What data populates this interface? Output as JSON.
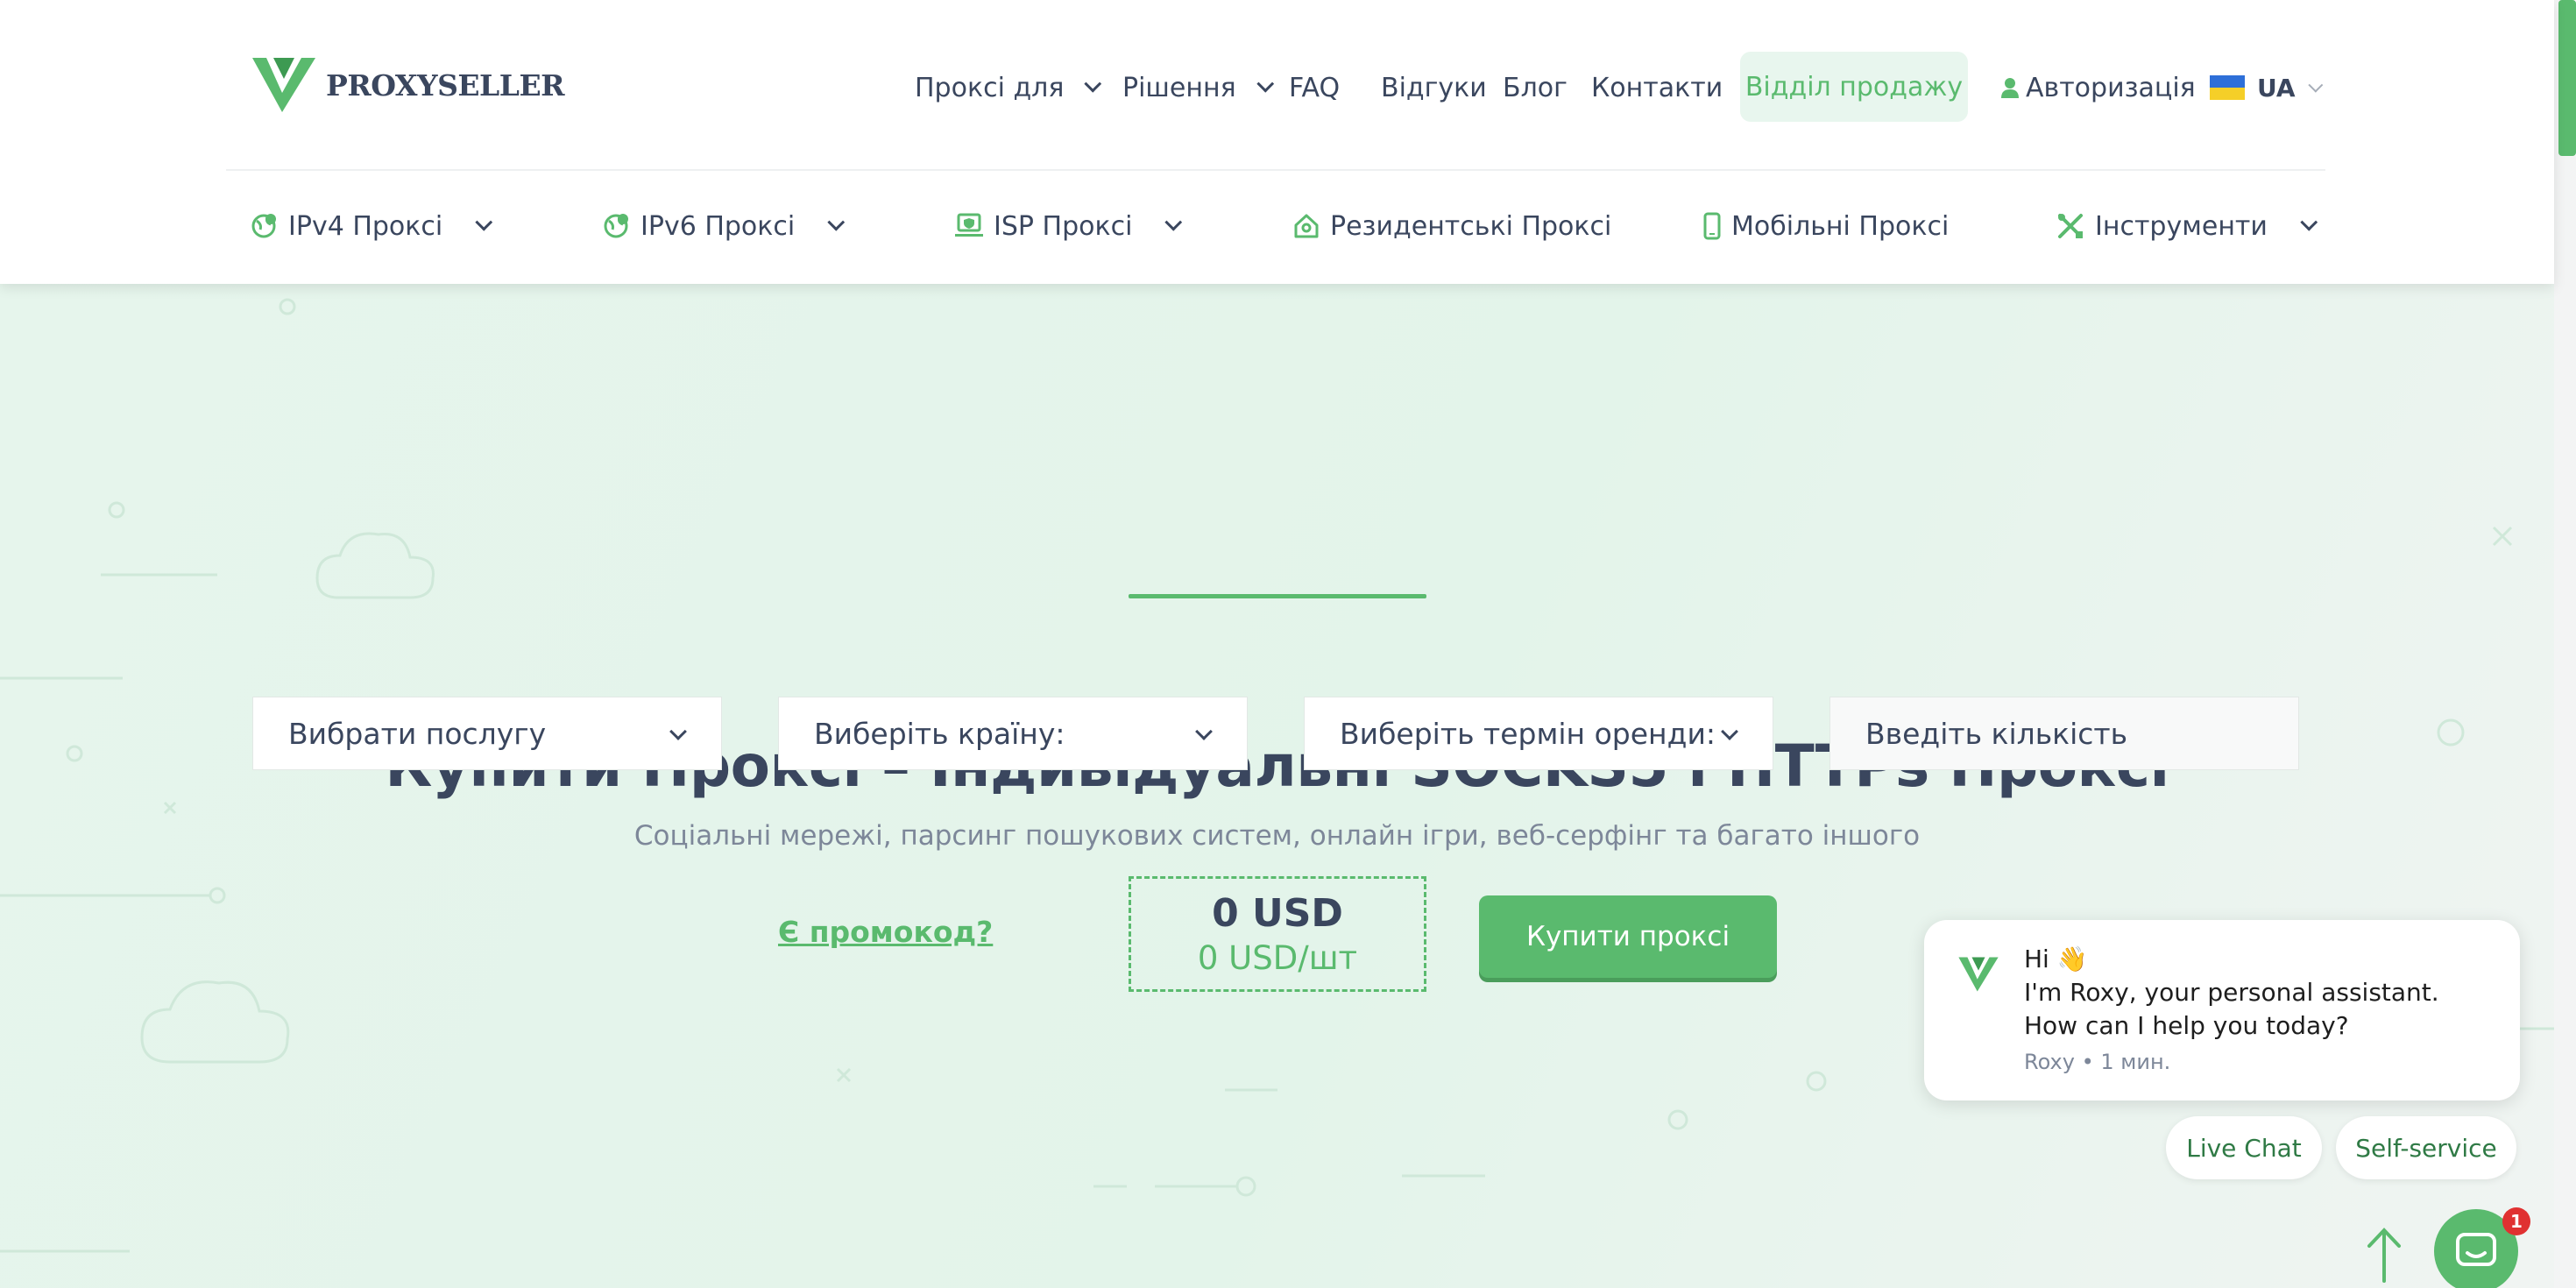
{
  "brand": {
    "name": "PROXYSELLER",
    "accent": "#5aba6e",
    "text": "#3a465e"
  },
  "topnav": {
    "items": [
      {
        "label": "Проксі для",
        "has_dropdown": true
      },
      {
        "label": "Рішення",
        "has_dropdown": true
      },
      {
        "label": "FAQ",
        "has_dropdown": false
      },
      {
        "label": "Відгуки",
        "has_dropdown": false
      },
      {
        "label": "Блог",
        "has_dropdown": false
      },
      {
        "label": "Контакти",
        "has_dropdown": false
      }
    ],
    "sales_button": "Відділ продажу",
    "auth_label": "Авторизація",
    "lang": "UA"
  },
  "subnav": {
    "items": [
      {
        "label": "IPv4 Проксі",
        "icon": "globe-pin-icon",
        "has_dropdown": true
      },
      {
        "label": "IPv6 Проксі",
        "icon": "globe-pin-icon",
        "has_dropdown": true
      },
      {
        "label": "ISP Проксі",
        "icon": "laptop-shield-icon",
        "has_dropdown": true
      },
      {
        "label": "Резидентські Проксі",
        "icon": "home-icon",
        "has_dropdown": false
      },
      {
        "label": "Мобільні Проксі",
        "icon": "smartphone-icon",
        "has_dropdown": false
      },
      {
        "label": "Інструменти",
        "icon": "tools-icon",
        "has_dropdown": true
      }
    ]
  },
  "hero": {
    "title": "Купити Проксі – Індивідуальні SOCKS5 і HTTPs Проксі",
    "subtitle": "Соціальні мережі, парсинг пошукових систем, онлайн ігри, веб-серфінг та багато іншого"
  },
  "order_form": {
    "service_select": "Вибрати послугу",
    "country_select": "Виберіть країну:",
    "term_select": "Виберіть термін оренди:",
    "quantity_placeholder": "Введіть кількість",
    "promo_link": "Є промокод?",
    "price_total": "0 USD",
    "price_per_unit": "0 USD/шт",
    "buy_button": "Купити проксі"
  },
  "chat": {
    "greeting": "Hi 👋",
    "line1": "I'm Roxy, your personal assistant.",
    "line2": "How can I help you today?",
    "meta": "Roxy • 1 мин.",
    "live_chat_button": "Live Chat",
    "self_service_button": "Self-service",
    "unread_count": "1"
  }
}
